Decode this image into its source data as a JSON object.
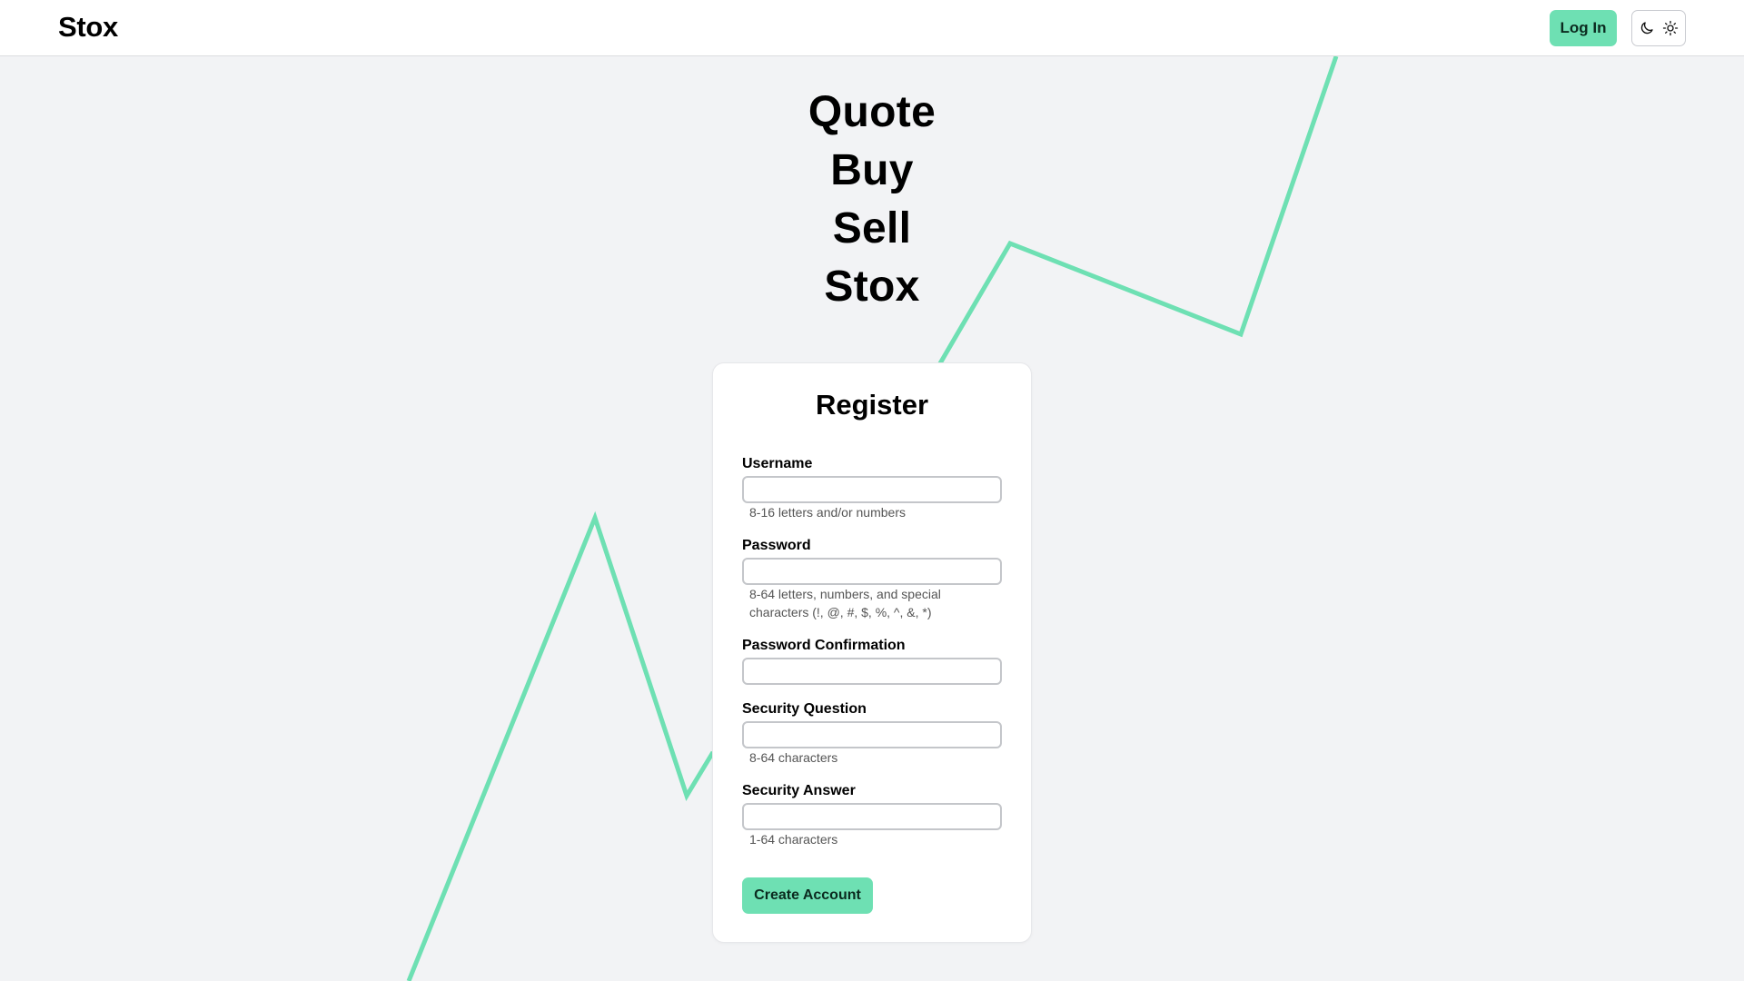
{
  "header": {
    "logo": "Stox",
    "login_label": "Log In",
    "theme_toggle": {
      "icons": [
        "moon-icon",
        "sun-icon"
      ]
    }
  },
  "hero": {
    "words": [
      "Quote",
      "Buy",
      "Sell",
      "Stox"
    ]
  },
  "register": {
    "title": "Register",
    "fields": [
      {
        "label": "Username",
        "value": "",
        "hint": "8-16 letters and/or numbers"
      },
      {
        "label": "Password",
        "value": "",
        "hint": "8-64 letters, numbers, and special characters (!, @, #, $, %, ^, &, *)"
      },
      {
        "label": "Password Confirmation",
        "value": "",
        "hint": ""
      },
      {
        "label": "Security Question",
        "value": "",
        "hint": "8-64 characters"
      },
      {
        "label": "Security Answer",
        "value": "",
        "hint": "1-64 characters"
      }
    ],
    "submit_label": "Create Account"
  },
  "colors": {
    "accent": "#6ee0b3",
    "background": "#f2f3f5",
    "card": "#ffffff"
  }
}
